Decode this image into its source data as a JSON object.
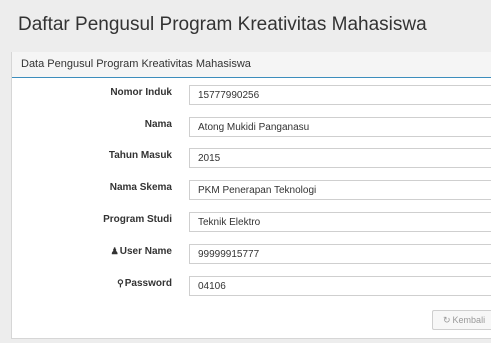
{
  "page": {
    "title": "Daftar Pengusul Program Kreativitas Mahasiswa"
  },
  "panel": {
    "heading": "Data Pengusul Program Kreativitas Mahasiswa"
  },
  "form": {
    "fields": [
      {
        "label": "Nomor Induk",
        "value": "15777990256",
        "icon": ""
      },
      {
        "label": "Nama",
        "value": "Atong Mukidi Panganasu",
        "icon": ""
      },
      {
        "label": "Tahun Masuk",
        "value": "2015",
        "icon": ""
      },
      {
        "label": "Nama Skema",
        "value": "PKM Penerapan Teknologi",
        "icon": ""
      },
      {
        "label": "Program Studi",
        "value": "Teknik Elektro",
        "icon": ""
      },
      {
        "label": "User Name",
        "value": "99999915777",
        "icon": "user-icon"
      },
      {
        "label": "Password",
        "value": "04106",
        "icon": "key-icon"
      }
    ]
  },
  "actions": {
    "back_label": "Kembali",
    "back_icon": "undo-icon"
  }
}
